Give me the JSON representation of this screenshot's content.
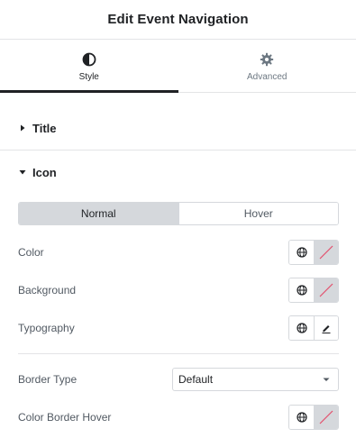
{
  "header": {
    "title": "Edit Event Navigation"
  },
  "tabs": [
    {
      "label": "Style",
      "icon": "half-circle-icon",
      "active": true
    },
    {
      "label": "Advanced",
      "icon": "gear-icon",
      "active": false
    }
  ],
  "sections": {
    "title": {
      "label": "Title",
      "state": "collapsed"
    },
    "icon": {
      "label": "Icon",
      "state": "expanded"
    }
  },
  "state_switcher": {
    "normal": "Normal",
    "hover": "Hover",
    "selected": "Normal"
  },
  "controls": {
    "color": {
      "label": "Color"
    },
    "background": {
      "label": "Background"
    },
    "typography": {
      "label": "Typography"
    },
    "border_type": {
      "label": "Border Type",
      "value": "Default"
    },
    "color_border_hover": {
      "label": "Color Border Hover"
    }
  },
  "colors": {
    "accent": "#1f2124",
    "swatch_empty": "#d5d8dc",
    "swatch_slash": "#e2506c"
  }
}
